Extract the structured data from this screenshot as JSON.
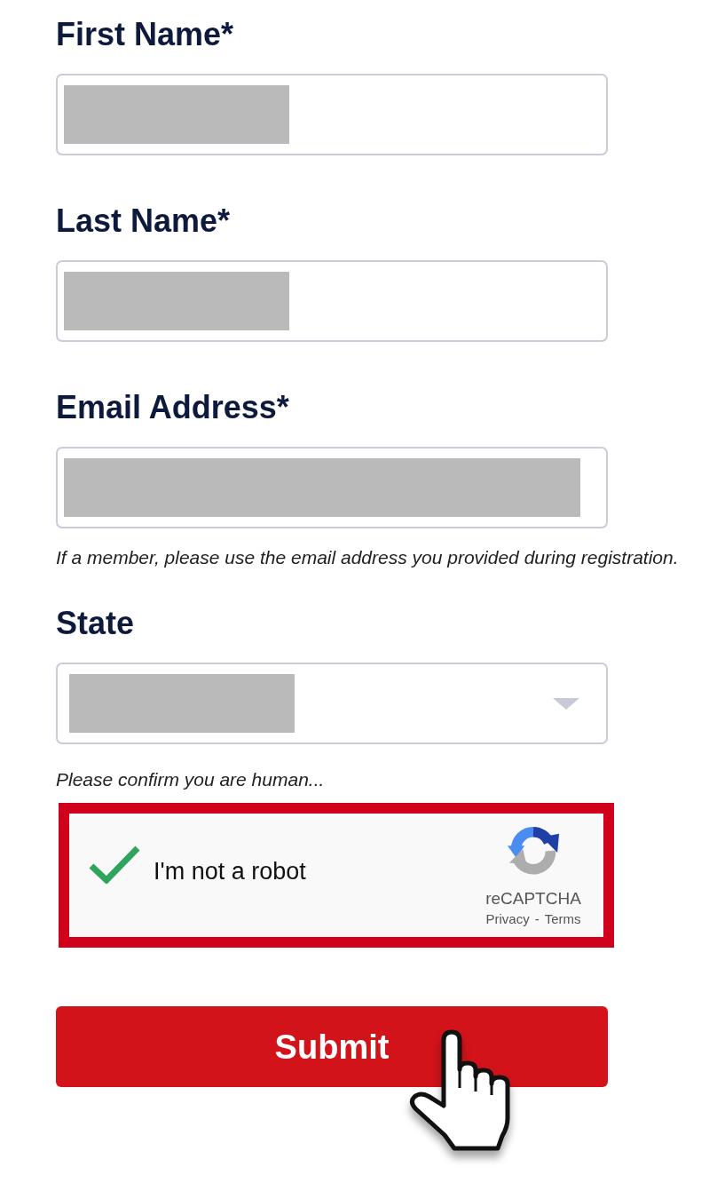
{
  "fields": [
    {
      "kind": "text",
      "label": "First Name*",
      "redacted": true
    },
    {
      "kind": "text",
      "label": "Last Name*",
      "redacted": true
    },
    {
      "kind": "email",
      "label": "Email Address*",
      "redacted": true,
      "hint": "If a member, please use the email address you provided during registration."
    },
    {
      "kind": "select",
      "label": "State",
      "redacted": true
    }
  ],
  "captcha": {
    "prompt": "Please confirm you are human...",
    "highlighted": true,
    "checked": true,
    "label": "I'm not a robot",
    "brand": "reCAPTCHA",
    "links": [
      "Privacy",
      "Terms"
    ],
    "separator": "-"
  },
  "submit_button": {
    "label": "Submit"
  }
}
